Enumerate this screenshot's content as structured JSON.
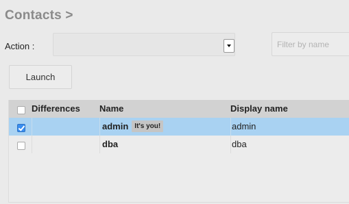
{
  "header": {
    "title": "Contacts >"
  },
  "toolbar": {
    "action_label": "Action :",
    "action_selected": "",
    "filter_placeholder": "Filter by name",
    "launch_label": "Launch"
  },
  "table": {
    "columns": {
      "differences": "Differences",
      "name": "Name",
      "display_name": "Display name"
    },
    "rows": [
      {
        "checked": true,
        "selected": true,
        "name": "admin",
        "badge": "It's you!",
        "display_name": "admin"
      },
      {
        "checked": false,
        "selected": false,
        "name": "dba",
        "badge": "",
        "display_name": "dba"
      }
    ]
  },
  "colors": {
    "selected_row": "#a9d2f2",
    "header_row": "#d2d2d2",
    "checkbox_checked": "#3a8ef0",
    "title": "#8a8a8a"
  }
}
